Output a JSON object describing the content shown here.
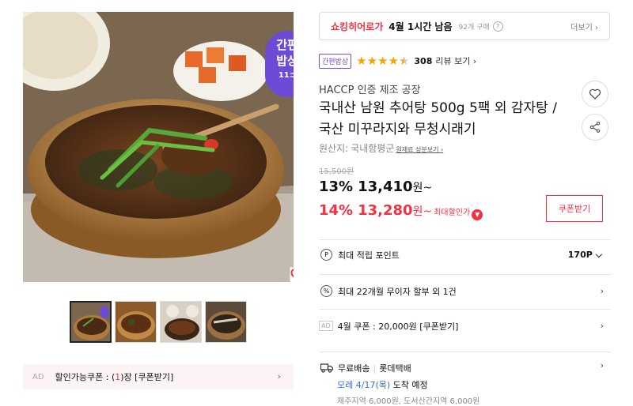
{
  "gallery": {
    "badge_line1": "간편",
    "badge_line2": "밥상",
    "badge_logo": "11⊃",
    "thumbnail_count": 4,
    "selected_thumbnail": 1
  },
  "ad_coupon": {
    "ad_label": "AD",
    "text_prefix": "할인가능쿠폰 : (",
    "count": "1",
    "text_suffix": ")장 [쿠폰받기]"
  },
  "deal": {
    "name": "쇼킹히어로가",
    "remaining": "4월 1시간 남음",
    "buyers": "92개 구매",
    "help": "?",
    "more": "더보기 ›"
  },
  "rating": {
    "tag": "간편밥상",
    "stars": 4.5,
    "review_count": "308",
    "review_link": "리뷰 보기 ›"
  },
  "product": {
    "seller": "HACCP 인증 제조 공장",
    "title": "국내산 남원 추어탕 500g 5팩 외 감자탕 / 국산 미꾸라지와 무청시래기",
    "origin_label": "원산지:",
    "origin_value": "국내함평군",
    "origin_detail": "원재료 성분보기 ›"
  },
  "price": {
    "original": "15,500원",
    "discount1_pct": "13%",
    "discount1_value": "13,410",
    "discount1_unit": "원~",
    "discount2_pct": "14%",
    "discount2_value": "13,280",
    "discount2_unit": "원~",
    "max_discount_label": "최대할인가",
    "coupon_button": "쿠폰받기"
  },
  "benefits": {
    "points_icon": "P",
    "points_label": "최대 적립 포인트",
    "points_value": "170P",
    "installment_icon": "%",
    "installment_label": "최대 22개월 무이자 할부 외 1건",
    "coupon_ad": "AD",
    "coupon_label": "4월 쿠폰 : 20,000원 [쿠폰받기]"
  },
  "shipping": {
    "type": "무료배송",
    "carrier": "롯데택배",
    "arrival_date": "모레 4/17(목)",
    "arrival_suffix": "도착 예정",
    "extra": "제주지역 6,000원, 도서산간지역 6,000원"
  },
  "colors": {
    "accent_red": "#f43142",
    "badge_purple": "#6d4bd6",
    "star_gold": "#f3a700",
    "link_blue": "#2f6fe4"
  },
  "icons": [
    "zoom-icon",
    "heart-icon",
    "share-icon",
    "chevron-right-icon",
    "chevron-down-icon",
    "truck-icon",
    "point-icon",
    "percent-icon",
    "help-icon"
  ]
}
